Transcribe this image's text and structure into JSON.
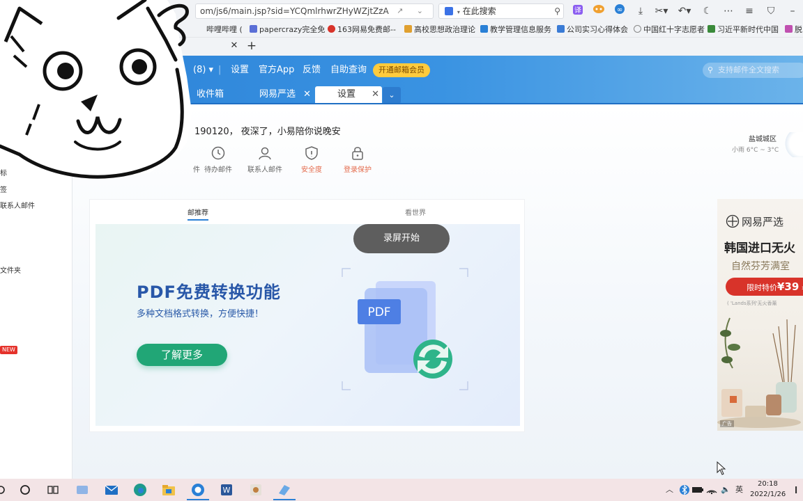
{
  "browser": {
    "address": "om/js6/main.jsp?sid=YCQmlrhwrZHyWZjtZzA",
    "search_text": "在此搜索",
    "bookmarks": [
      {
        "label": "哔哩哔哩 (",
        "color": "#fb7299"
      },
      {
        "label": "papercrazy完全免",
        "color": "#5b6fd6"
      },
      {
        "label": "163网易免费邮--",
        "color": "#d8332a"
      },
      {
        "label": "高校思想政治理论",
        "color": "#e0a030"
      },
      {
        "label": "教学管理信息服务",
        "color": "#2a80d6"
      },
      {
        "label": "公司实习心得体会",
        "color": "#3a7bd5"
      },
      {
        "label": "中国红十字志愿者",
        "color": "#888888"
      },
      {
        "label": "习近平新时代中国",
        "color": "#3a8a3a"
      },
      {
        "label": "脱",
        "color": "#c050b0"
      }
    ]
  },
  "mail": {
    "nav_count": "(8)",
    "nav": [
      "设置",
      "官方App",
      "反馈",
      "自助查询"
    ],
    "vip": "开通邮箱会员",
    "search_placeholder": "支持邮件全文搜索",
    "tabs": [
      {
        "label": "收件箱"
      },
      {
        "label": "网易严选"
      },
      {
        "label": "设置"
      }
    ],
    "greeting": "190120， 夜深了，小易陪你说晚安",
    "quick_actions": [
      {
        "label": "件"
      },
      {
        "label": "待办邮件"
      },
      {
        "label": "联系人邮件"
      },
      {
        "label": "安全度"
      },
      {
        "label": "登录保护"
      }
    ],
    "weather": {
      "city": "盐城城区",
      "info": "小雨 6°C ~ 3°C"
    },
    "sidebar": [
      "标",
      "签",
      "联系人邮件",
      "文件夹"
    ],
    "new_badge": "NEW"
  },
  "recommend": {
    "tabs": [
      "邮推荐",
      "看世界"
    ],
    "banner_title": "PDF免费转换功能",
    "banner_sub": "多种文档格式转换，方便快捷！",
    "banner_button": "了解更多",
    "pdf_label": "PDF"
  },
  "overlay": {
    "record": "录屏开始"
  },
  "ad": {
    "brand": "网易严选",
    "headline": "韩国进口无火",
    "tagline": "自然芬芳满室",
    "price_prefix": "限时特价",
    "price": "¥39",
    "note": "( 'Lands系列'无火香薰",
    "label": "广告"
  },
  "taskbar": {
    "time": "20:18",
    "date": "2022/1/26",
    "ime": "英"
  }
}
